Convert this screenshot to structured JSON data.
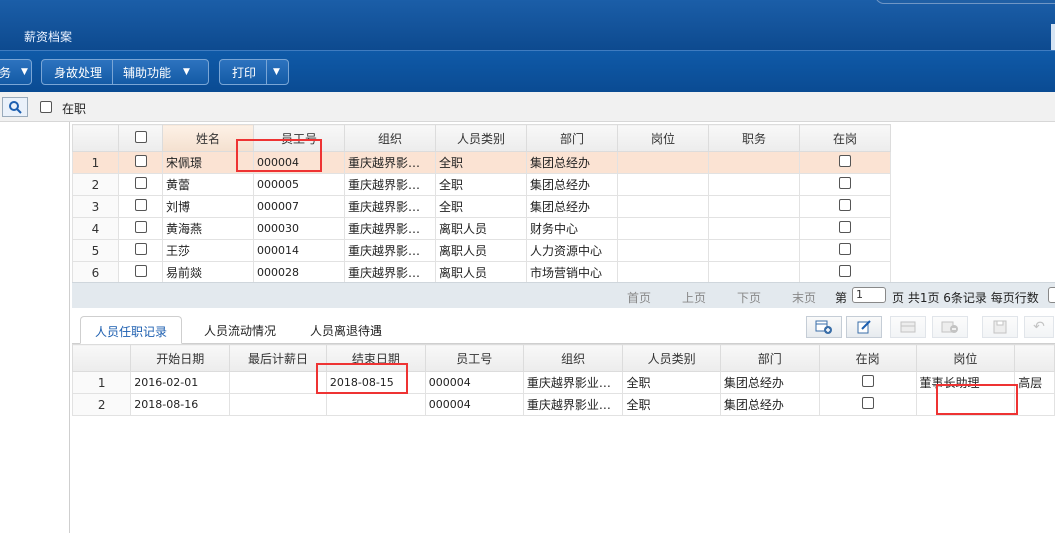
{
  "header": {
    "module_title": "薪资档案"
  },
  "toolbar": {
    "partial_label": "务",
    "accident_label": "身故处理",
    "aux_label": "辅助功能",
    "print_label": "打印"
  },
  "filter": {
    "on_job_label": "在职"
  },
  "grid1": {
    "headers": [
      "姓名",
      "员工号",
      "组织",
      "人员类别",
      "部门",
      "岗位",
      "职务",
      "在岗"
    ],
    "rows": [
      {
        "no": "1",
        "name": "宋佩璟",
        "id": "000004",
        "org": "重庆越界影…",
        "type": "全职",
        "dept": "集团总经办"
      },
      {
        "no": "2",
        "name": "黄蕾",
        "id": "000005",
        "org": "重庆越界影…",
        "type": "全职",
        "dept": "集团总经办"
      },
      {
        "no": "3",
        "name": "刘博",
        "id": "000007",
        "org": "重庆越界影…",
        "type": "全职",
        "dept": "集团总经办"
      },
      {
        "no": "4",
        "name": "黄海燕",
        "id": "000030",
        "org": "重庆越界影…",
        "type": "离职人员",
        "dept": "财务中心"
      },
      {
        "no": "5",
        "name": "王莎",
        "id": "000014",
        "org": "重庆越界影…",
        "type": "离职人员",
        "dept": "人力资源中心"
      },
      {
        "no": "6",
        "name": "易前燚",
        "id": "000028",
        "org": "重庆越界影…",
        "type": "离职人员",
        "dept": "市场营销中心"
      }
    ]
  },
  "pager": {
    "first": "首页",
    "prev": "上页",
    "next": "下页",
    "last": "末页",
    "page_prefix": "第",
    "page_value": "1",
    "page_suffix": "页 共1页 6条记录 每页行数"
  },
  "tabs": [
    "人员任职记录",
    "人员流动情况",
    "人员离退待遇"
  ],
  "grid2": {
    "headers": [
      "开始日期",
      "最后计薪日",
      "结束日期",
      "员工号",
      "组织",
      "人员类别",
      "部门",
      "在岗",
      "岗位"
    ],
    "rows": [
      {
        "no": "1",
        "start": "2016-02-01",
        "last": "",
        "end": "2018-08-15",
        "id": "000004",
        "org": "重庆越界影业…",
        "type": "全职",
        "dept": "集团总经办",
        "post": "董事长助理",
        "extra": "高层"
      },
      {
        "no": "2",
        "start": "2018-08-16",
        "last": "",
        "end": "",
        "id": "000004",
        "org": "重庆越界影业…",
        "type": "全职",
        "dept": "集团总经办",
        "post": "",
        "extra": ""
      }
    ]
  }
}
